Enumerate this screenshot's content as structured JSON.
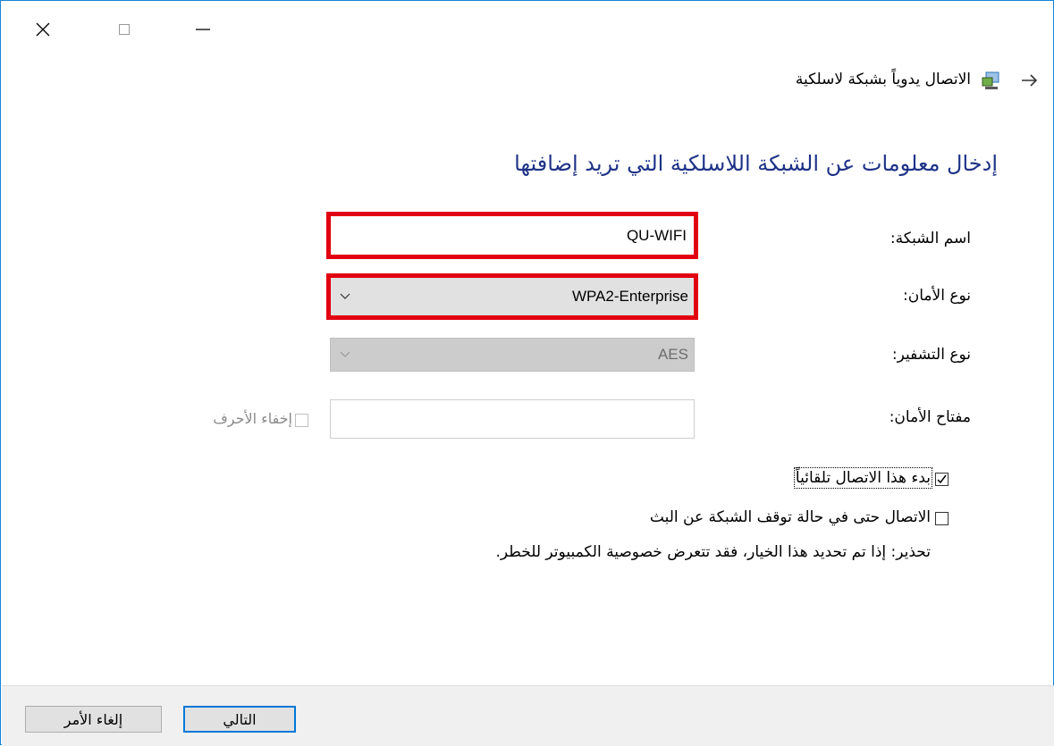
{
  "window": {
    "breadcrumb_title": "الاتصال يدوياً بشبكة لاسلكية"
  },
  "page": {
    "heading": "إدخال معلومات عن الشبكة اللاسلكية التي تريد إضافتها"
  },
  "form": {
    "network_name": {
      "label": "اسم الشبكة:",
      "value": "QU-WIFI"
    },
    "security_type": {
      "label": "نوع الأمان:",
      "value": "WPA2-Enterprise"
    },
    "encryption_type": {
      "label": "نوع التشفير:",
      "value": "AES"
    },
    "security_key": {
      "label": "مفتاح الأمان:",
      "value": ""
    },
    "hide_characters": {
      "label": "إخفاء الأحرف",
      "checked": false
    },
    "auto_connect": {
      "label": "بدء هذا الاتصال تلقائياً",
      "checked": true
    },
    "connect_not_broadcasting": {
      "label": "الاتصال حتى في حالة توقف الشبكة عن البث",
      "checked": false
    },
    "warning": "تحذير: إذا تم تحديد هذا الخيار، فقد تتعرض خصوصية الكمبيوتر للخطر."
  },
  "buttons": {
    "next": "التالي",
    "cancel": "إلغاء الأمر"
  },
  "colors": {
    "accent_border": "#1883d7",
    "heading_blue": "#1e3287",
    "highlight_red": "#e1000f"
  }
}
